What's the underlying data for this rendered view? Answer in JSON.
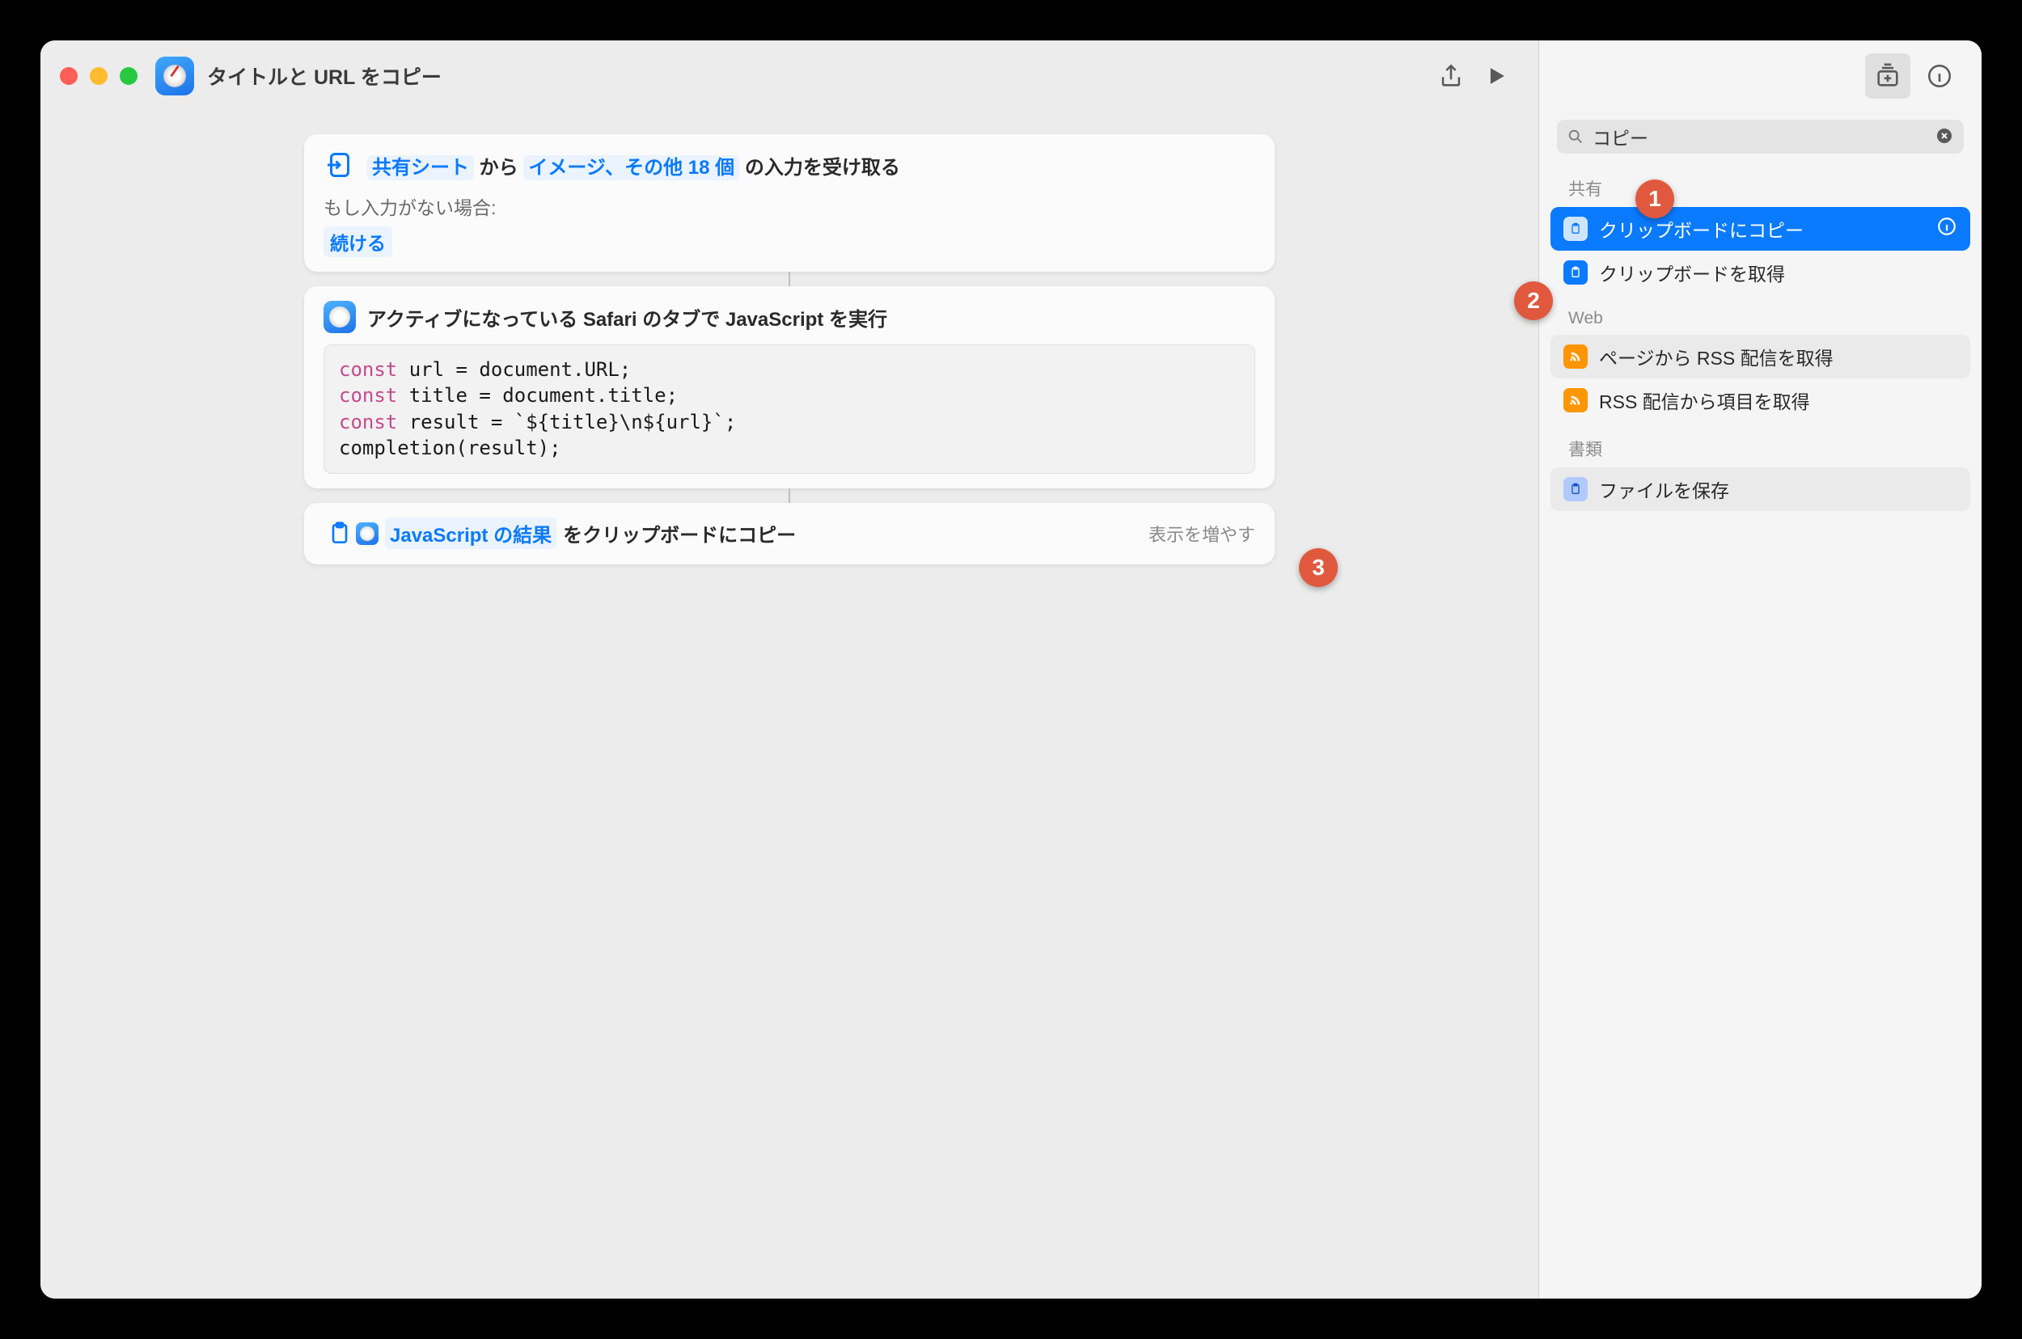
{
  "window": {
    "title": "タイトルと URL をコピー"
  },
  "receive": {
    "source": "共有シート",
    "middle": "から",
    "types": "イメージ、その他 18 個",
    "suffix": "の入力を受け取る",
    "noinput_label": "もし入力がない場合:",
    "continue": "続ける"
  },
  "js_action": {
    "title": "アクティブになっている Safari のタブで JavaScript を実行",
    "code_lines": [
      {
        "kw": "const",
        "rest": " url = document.URL;"
      },
      {
        "kw": "const",
        "rest": " title = document.title;"
      },
      {
        "kw": "const",
        "rest": " result = `${title}\\n${url}`;"
      },
      {
        "kw": "",
        "rest": "completion(result);"
      }
    ]
  },
  "copy_action": {
    "variable": "JavaScript の結果",
    "suffix": "をクリップボードにコピー",
    "show_more": "表示を増やす"
  },
  "sidebar": {
    "search_value": "コピー",
    "categories": [
      {
        "label": "共有",
        "items": [
          {
            "label": "クリップボードにコピー",
            "selected": true,
            "icon": "lite"
          },
          {
            "label": "クリップボードを取得",
            "selected": false,
            "icon": "blue"
          }
        ]
      },
      {
        "label": "Web",
        "items": [
          {
            "label": "ページから RSS 配信を取得",
            "alt": true,
            "icon": "orange"
          },
          {
            "label": "RSS 配信から項目を取得",
            "icon": "orange"
          }
        ]
      },
      {
        "label": "書類",
        "items": [
          {
            "label": "ファイルを保存",
            "alt": true,
            "icon": "doc"
          }
        ]
      }
    ]
  },
  "badges": [
    "1",
    "2",
    "3"
  ]
}
